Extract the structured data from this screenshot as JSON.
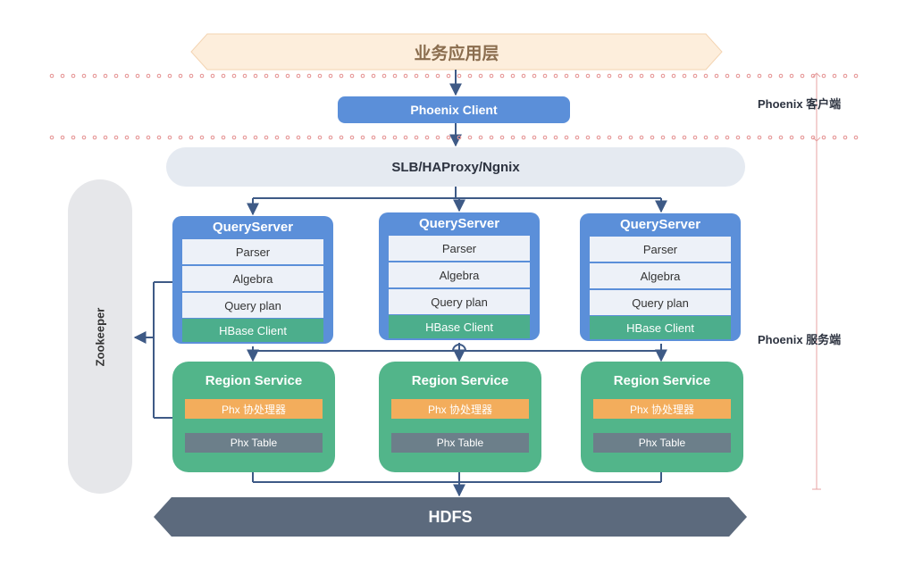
{
  "business_layer": {
    "label": "业务应用层"
  },
  "phoenix_client": {
    "label": "Phoenix Client"
  },
  "load_balancer": {
    "label": "SLB/HAProxy/Ngnix"
  },
  "zookeeper": {
    "label": "Zookeeper"
  },
  "query_servers": [
    {
      "title": "QueryServer",
      "parser": "Parser",
      "algebra": "Algebra",
      "query_plan": "Query plan",
      "hbase_client": "HBase Client"
    },
    {
      "title": "QueryServer",
      "parser": "Parser",
      "algebra": "Algebra",
      "query_plan": "Query plan",
      "hbase_client": "HBase Client"
    },
    {
      "title": "QueryServer",
      "parser": "Parser",
      "algebra": "Algebra",
      "query_plan": "Query plan",
      "hbase_client": "HBase Client"
    }
  ],
  "region_services": [
    {
      "title": "Region Service",
      "coprocessor": "Phx 协处理器",
      "table": "Phx Table"
    },
    {
      "title": "Region Service",
      "coprocessor": "Phx 协处理器",
      "table": "Phx Table"
    },
    {
      "title": "Region Service",
      "coprocessor": "Phx 协处理器",
      "table": "Phx Table"
    }
  ],
  "hdfs": {
    "label": "HDFS"
  },
  "side_labels": {
    "client_side": "Phoenix 客户端",
    "server_side": "Phoenix 服务端"
  },
  "colors": {
    "client_blue": "#5b8fd9",
    "hbase_green": "#4cae8c",
    "region_green": "#52b58a",
    "coprocessor_orange": "#f3ad5c",
    "table_gray": "#6c7f8a",
    "hdfs_slate": "#5c6a7d",
    "top_layer_fill": "#fdeedc",
    "divider_red": "#e79a9a",
    "arrow_dark": "#3e5a86"
  }
}
